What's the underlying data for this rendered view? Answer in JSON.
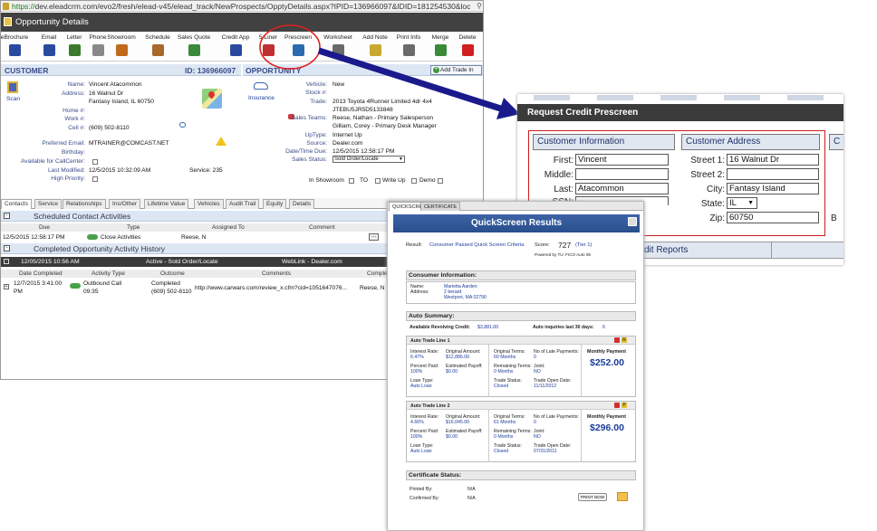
{
  "browser": {
    "url_secure": "https://",
    "url_rest": "dev.eleadcrm.com/evo2/fresh/elead-v45/elead_track/NewProspects/OpptyDetails.aspx?IPID=136966097&IDID=181254530&loc"
  },
  "window_title": "Opportunity Details",
  "toolbar": [
    {
      "label": "eBrochure",
      "icon": "brochure-icon",
      "color": "#2a4aa0"
    },
    {
      "label": "Email",
      "icon": "email-icon",
      "color": "#2a4aa0"
    },
    {
      "label": "Letter",
      "icon": "letter-icon",
      "color": "#3a7a2a"
    },
    {
      "label": "Phone",
      "icon": "phone-icon",
      "color": "#888888"
    },
    {
      "label": "Showroom",
      "icon": "showroom-icon",
      "color": "#c06a1a"
    },
    {
      "label": "Schedule",
      "icon": "schedule-icon",
      "color": "#a8682a"
    },
    {
      "label": "Sales Quote",
      "icon": "sales-quote-icon",
      "color": "#3a8a3a"
    },
    {
      "label": "Credit App",
      "icon": "credit-app-icon",
      "color": "#2a4aa0"
    },
    {
      "label": "5 Liner",
      "icon": "five-liner-icon",
      "color": "#c03030"
    },
    {
      "label": "Prescreen",
      "icon": "prescreen-icon",
      "color": "#2a6ab0"
    },
    {
      "label": "Worksheet",
      "icon": "worksheet-icon",
      "color": "#6a6a6a"
    },
    {
      "label": "Add Note",
      "icon": "add-note-icon",
      "color": "#c8a830"
    },
    {
      "label": "Print Info",
      "icon": "print-icon",
      "color": "#6a6a6a"
    },
    {
      "label": "Merge",
      "icon": "merge-icon",
      "color": "#3a8a3a"
    },
    {
      "label": "Delete",
      "icon": "delete-icon",
      "color": "#d02020"
    }
  ],
  "customer": {
    "heading": "CUSTOMER",
    "id_label": "ID: 136966097",
    "scan_label": "Scan",
    "fields": [
      {
        "label": "Name:",
        "value": "Vincent Atacommon"
      },
      {
        "label": "Address:",
        "value": "16 Walnut Dr"
      },
      {
        "label": "",
        "value": "Fantasy Island, IL 60750"
      },
      {
        "label": "Home #:",
        "value": ""
      },
      {
        "label": "Work #:",
        "value": ""
      },
      {
        "label": "Cell #:",
        "value": "(609) 502-8110"
      },
      {
        "label": "Birthday:",
        "value": ""
      },
      {
        "label": "Preferred Email:",
        "value": "MTRAINER@COMCAST.NET"
      },
      {
        "label": "Birthday:",
        "value": ""
      },
      {
        "label": "Available for CallCenter:",
        "value": ""
      },
      {
        "label": "Last Modified:",
        "value": "12/5/2015 10:32:09 AM"
      },
      {
        "label": "High Priority:",
        "value": ""
      }
    ],
    "service_label": "Service: 235"
  },
  "opportunity": {
    "heading": "OPPORTUNITY",
    "add_trade_in": "Add Trade In",
    "insurance_label": "Insurance",
    "fields": [
      {
        "label": "Vehicle:",
        "value": "New"
      },
      {
        "label": "Stock #:",
        "value": ""
      },
      {
        "label": "Trade:",
        "value": "2013 Toyota 4Runner Limited 4dr 4x4"
      },
      {
        "label": "",
        "value": "JTEBU5JR5D5133848"
      },
      {
        "label": "Sales Teams:",
        "value": "Reese, Nathan  - Primary Salesperson"
      },
      {
        "label": "",
        "value": "Gilliam, Corey  - Primary Desk Manager"
      },
      {
        "label": "UpType:",
        "value": "Internet Up"
      },
      {
        "label": "Source:",
        "value": "Dealer.com"
      },
      {
        "label": "Date/Time Due:",
        "value": "12/5/2015 12:58:17 PM"
      },
      {
        "label": "Sales Status:",
        "value": "Sold Order/Locate"
      }
    ],
    "checks": [
      "In Showroom",
      "TO",
      "Write Up",
      "Demo"
    ]
  },
  "tabs": [
    "Contacts",
    "Service",
    "Relationships",
    "Ins/Other",
    "Lifetime Value",
    "Vehicles",
    "Audit Trail",
    "Equity",
    "Details"
  ],
  "scheduled": {
    "heading": "Scheduled Contact Activities",
    "columns": [
      "Due",
      "Type",
      "Assigned To",
      "Comment"
    ],
    "row": {
      "due": "12/5/2015 12:58:17 PM",
      "type": "Close Activities",
      "assigned": "Reese, N",
      "comment": "..."
    }
  },
  "completed": {
    "heading": "Completed Opportunity Activity History",
    "bar_date": "12/05/2015 10:56 AM",
    "bar_status": "Active - Sold Order/Locate",
    "bar_source": "WebLink - Dealer.com",
    "columns": [
      "Date Completed",
      "Activity Type",
      "Outcome",
      "Comments",
      "Comple"
    ],
    "row": {
      "date1": "12/7/2015 3:41:00",
      "date2": "PM",
      "type1": "Outbound Call",
      "type2": "09:35",
      "outcome1": "Completed",
      "outcome2": "(609) 502-8110",
      "comment": "http://www.carwars.com/review_x.cfm?cid=1051647076...",
      "by": "Reese, N"
    }
  },
  "prescreen": {
    "title": "Request Credit Prescreen",
    "cust_box_title": "Customer Information",
    "addr_box_title": "Customer Address",
    "third_box_letter": "C",
    "first_label": "First:",
    "first": "Vincent",
    "middle_label": "Middle:",
    "middle": "",
    "last_label": "Last:",
    "last": "Atacommon",
    "ssn_label": "SSN:",
    "street1_label": "Street 1:",
    "street1": "16 Walnut Dr",
    "street2_label": "Street 2:",
    "street2": "",
    "city_label": "City:",
    "city": "Fantasy Island",
    "state_label": "State:",
    "state": "IL",
    "zip_label": "Zip:",
    "zip": "60750",
    "side_letter": "B",
    "credit_reports": "dit Reports"
  },
  "quickscreen": {
    "tabs": [
      "QUICKSCREEN",
      "CERTIFICATE"
    ],
    "title": "QuickScreen Results",
    "result_label": "Result:",
    "result_value": "Consumer Passed Quick Screen Criteria",
    "score_label": "Score:",
    "score": "727",
    "tier": "(Tier 1)",
    "powered": "Powered by TU: FICO Auto 08",
    "consumer_heading": "Consumer Information:",
    "name_label": "Name:",
    "name": "Marietta Aarden",
    "address_label": "Address:",
    "address1": "2 berard",
    "address2": "Westport, MA 02790",
    "auto_heading": "Auto Summary:",
    "revolving_label": "Available Revolving Credit:",
    "revolving": "$3,881.00",
    "inquiries_label": "Auto inquiries last 30 days:",
    "inquiries": "6",
    "trade_lines": [
      {
        "title": "Auto Trade Line 1",
        "rate_label": "Interest Rate:",
        "rate": "6.47%",
        "orig_amt_label": "Original Amount:",
        "orig_amt": "$12,886.00",
        "orig_terms_label": "Original Terms:",
        "orig_terms": "60 Months",
        "late_label": "No of Late Payments:",
        "late": "0",
        "pct_label": "Percent Paid:",
        "pct": "100%",
        "payoff_label": "Estimated Payoff:",
        "payoff": "$0.00",
        "remain_label": "Remaining Terms:",
        "remain": "0 Months",
        "joint_label": "Joint:",
        "joint": "NO",
        "loan_label": "Loan Type:",
        "loan": "Auto Loan",
        "status_label": "Trade Status:",
        "status": "Closed",
        "open_label": "Trade Open Date:",
        "open": "11/11/2012",
        "monthly_label": "Monthly Payment",
        "monthly": "$252.00",
        "badge": "R"
      },
      {
        "title": "Auto Trade Line 2",
        "rate_label": "Interest Rate:",
        "rate": "4.66%",
        "orig_amt_label": "Original Amount:",
        "orig_amt": "$16,045.00",
        "orig_terms_label": "Original Terms:",
        "orig_terms": "61 Months",
        "late_label": "No of Late Payments:",
        "late": "0",
        "pct_label": "Percent Paid:",
        "pct": "100%",
        "payoff_label": "Estimated Payoff:",
        "payoff": "$0.00",
        "remain_label": "Remaining Terms:",
        "remain": "0 Months",
        "joint_label": "Joint:",
        "joint": "NO",
        "loan_label": "Loan Type:",
        "loan": "Auto Loan",
        "status_label": "Trade Status:",
        "status": "Closed",
        "open_label": "Trade Open Date:",
        "open": "07/31/2011",
        "monthly_label": "Monthly Payment",
        "monthly": "$296.00",
        "badge": "P"
      }
    ],
    "cert_heading": "Certificate Status:",
    "printed_label": "Printed By:",
    "printed": "N/A",
    "confirmed_label": "Confirmed By:",
    "confirmed": "N/A",
    "print_now": "PRINT NOW"
  }
}
